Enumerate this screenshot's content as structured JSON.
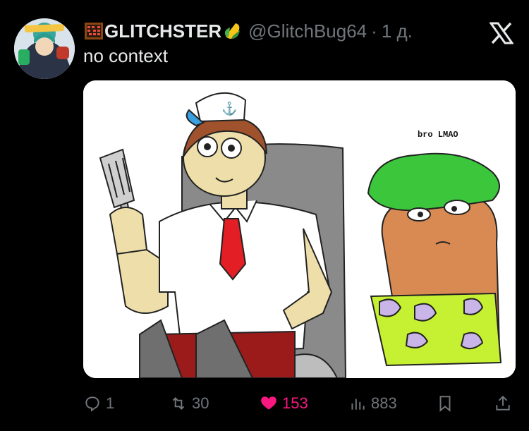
{
  "tweet": {
    "author_name": "GLITCHSTER",
    "author_handle": "@GlitchBug64",
    "separator": "·",
    "time": "1 д.",
    "text": "no context",
    "name_emoji_left": "abacus-emoji",
    "name_emoji_right": "corn-emoji",
    "media": {
      "caption_in_image": "bro LMAO"
    }
  },
  "actions": {
    "replies": "1",
    "retweets": "30",
    "likes": "153",
    "views": "883"
  },
  "colors": {
    "background": "#000000",
    "text_primary": "#e7e9ea",
    "text_secondary": "#71767b",
    "like_active": "#f91880"
  }
}
